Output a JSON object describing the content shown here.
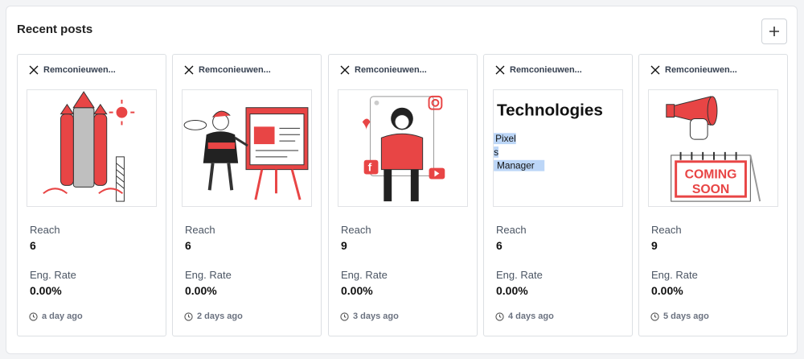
{
  "panel": {
    "title": "Recent posts"
  },
  "labels": {
    "reach": "Reach",
    "eng_rate": "Eng. Rate"
  },
  "icons": {
    "network": "x-twitter-icon",
    "time": "clock-icon",
    "add": "plus-icon"
  },
  "colors": {
    "accent": "#e84545",
    "dark": "#1f1f1f"
  },
  "posts": [
    {
      "account": "Remconieuwen...",
      "image": "rocket-illustration",
      "reach": "6",
      "eng_rate": "0.00%",
      "time": "a day ago"
    },
    {
      "account": "Remconieuwen...",
      "image": "painter-easel-illustration",
      "reach": "6",
      "eng_rate": "0.00%",
      "time": "2 days ago"
    },
    {
      "account": "Remconieuwen...",
      "image": "social-media-frame-illustration",
      "reach": "9",
      "eng_rate": "0.00%",
      "time": "3 days ago"
    },
    {
      "account": "Remconieuwen...",
      "image": "text-screenshot",
      "image_text": [
        "Technologies",
        "Pixel",
        "s",
        "Manager"
      ],
      "reach": "6",
      "eng_rate": "0.00%",
      "time": "4 days ago"
    },
    {
      "account": "Remconieuwen...",
      "image": "megaphone-coming-soon-illustration",
      "image_text": [
        "COMING",
        "SOON"
      ],
      "reach": "9",
      "eng_rate": "0.00%",
      "time": "5 days ago"
    }
  ]
}
